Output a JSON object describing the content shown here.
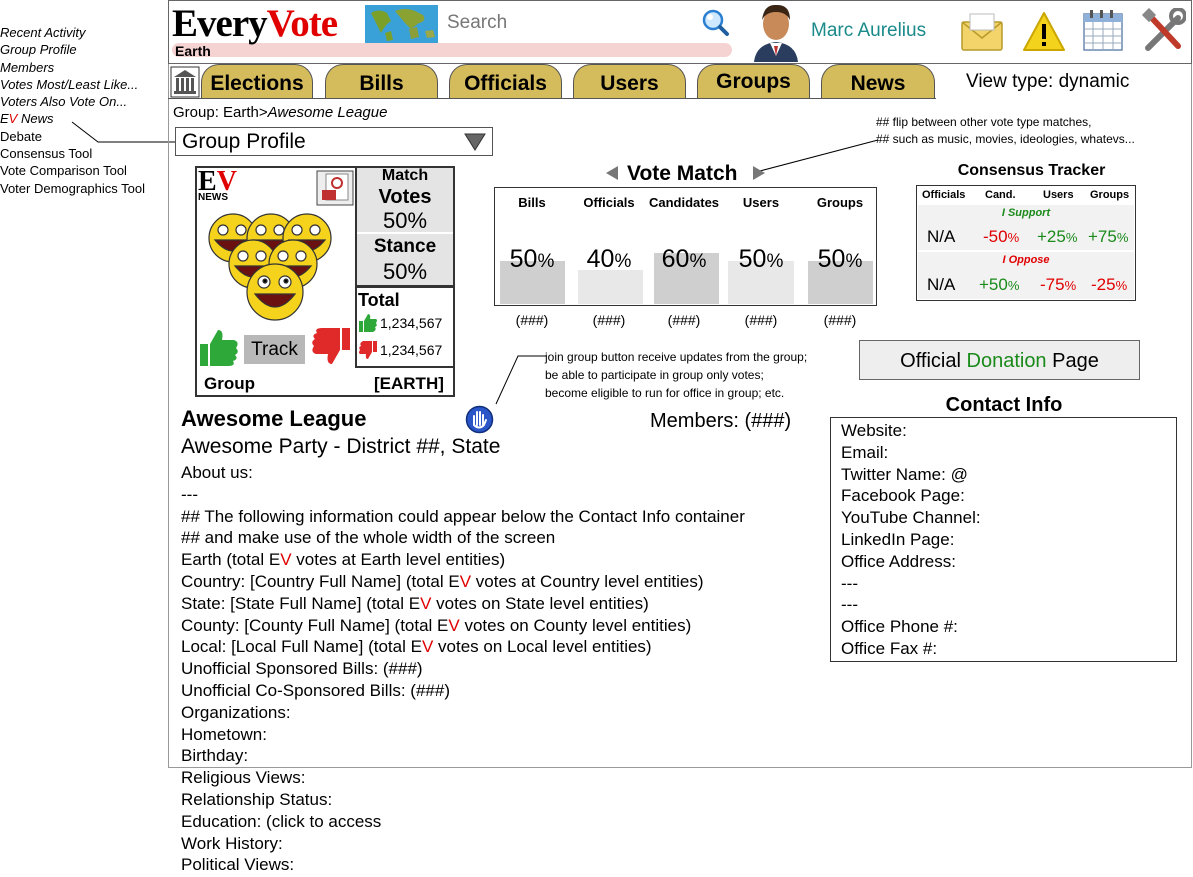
{
  "sidebar": {
    "items": [
      {
        "label": "Recent Activity",
        "italic": true
      },
      {
        "label": "Group Profile",
        "italic": true
      },
      {
        "label": "Members",
        "italic": true
      },
      {
        "label": "Votes Most/Least Like...",
        "italic": true
      },
      {
        "label": "Voters Also Vote On...",
        "italic": true
      },
      {
        "label": "Debate",
        "italic": false
      },
      {
        "label": "Consensus Tool",
        "italic": false
      },
      {
        "label": "Vote Comparison Tool",
        "italic": false
      },
      {
        "label": "Voter Demographics Tool",
        "italic": false
      }
    ],
    "ev_news": {
      "e": "E",
      "v": "V",
      "rest": " News"
    }
  },
  "header": {
    "logo_every": "Every",
    "logo_vote": "Vote",
    "location": "Earth",
    "search_placeholder": "Search",
    "user_name": "Marc Aurelius"
  },
  "tabs": [
    "Elections",
    "Bills",
    "Officials",
    "Users",
    "Groups",
    "News"
  ],
  "view_type": "View type: dynamic",
  "breadcrumb": {
    "prefix": "Group: Earth>",
    "current": "Awesome League"
  },
  "profile_select": "Group Profile",
  "card": {
    "ev_e": "E",
    "ev_v": "V",
    "news": "NEWS",
    "match": "Match",
    "votes_label": "Votes",
    "votes_pct": "50%",
    "stance_label": "Stance",
    "stance_pct": "50%",
    "total_label": "Total",
    "up_count": "1,234,567",
    "down_count": "1,234,567",
    "track": "Track",
    "group": "Group",
    "scope": "[EARTH]"
  },
  "vote_match": {
    "title": "Vote Match",
    "note1": "## flip between other vote type matches,",
    "note2": "## such as music, movies, ideologies, whatevs...",
    "columns": [
      {
        "label": "Bills",
        "value": "50",
        "count": "(###)"
      },
      {
        "label": "Officials",
        "value": "40",
        "count": "(###)"
      },
      {
        "label": "Candidates",
        "value": "60",
        "count": "(###)"
      },
      {
        "label": "Users",
        "value": "50",
        "count": "(###)"
      },
      {
        "label": "Groups",
        "value": "50",
        "count": "(###)"
      }
    ],
    "pct": "%"
  },
  "consensus": {
    "title": "Consensus Tracker",
    "headers": [
      "Officials",
      "Cand.",
      "Users",
      "Groups"
    ],
    "support_label": "I Support",
    "oppose_label": "I Oppose",
    "support": {
      "officials": "N/A",
      "cand": "-50",
      "users": "+25",
      "groups": "+75"
    },
    "oppose": {
      "officials": "N/A",
      "cand": "+50",
      "users": "-75",
      "groups": "-25"
    },
    "colors": {
      "pos": "#1a8a1a",
      "neg": "#e00000"
    }
  },
  "donation": {
    "pre": "Official ",
    "mid": "Donation",
    "post": " Page"
  },
  "join_note": [
    "join group button receive updates from the group;",
    "be able to participate in group only votes;",
    "become eligible to run for office in group; etc."
  ],
  "group": {
    "name": "Awesome League",
    "party": "Awesome Party - District ##, State",
    "members": "Members: (###)"
  },
  "contact": {
    "title": "Contact Info",
    "lines": [
      "Website:",
      "Email:",
      "Twitter Name: @",
      "Facebook Page:",
      "YouTube Channel:",
      "LinkedIn Page:",
      "Office Address:",
      "---",
      "---",
      "Office Phone #:",
      "Office Fax #:"
    ]
  },
  "details": {
    "lines_top": [
      "About us:",
      "---",
      "## The following information could appear below the Contact Info container",
      "## and make use of the whole width of the screen"
    ],
    "levels": [
      {
        "pre": "Earth (total ",
        "post": " votes at Earth level entities)"
      },
      {
        "pre": "Country: [Country Full Name] (total ",
        "post": " votes at Country level entities)"
      },
      {
        "pre": "State: [State Full Name] (total ",
        "post": " votes on State level entities)"
      },
      {
        "pre": "County: [County Full Name] (total ",
        "post": " votes on County level entities)"
      },
      {
        "pre": "Local: [Local Full Name] (total ",
        "post": " votes on Local level entities)"
      }
    ],
    "lines_bottom": [
      "Unofficial Sponsored Bills: (###)",
      "Unofficial Co-Sponsored Bills: (###)",
      "Organizations:",
      "Hometown:",
      "Birthday:",
      "Religious Views:",
      "Relationship Status:",
      "Education: (click to access",
      "Work History:",
      "Political Views:"
    ]
  }
}
